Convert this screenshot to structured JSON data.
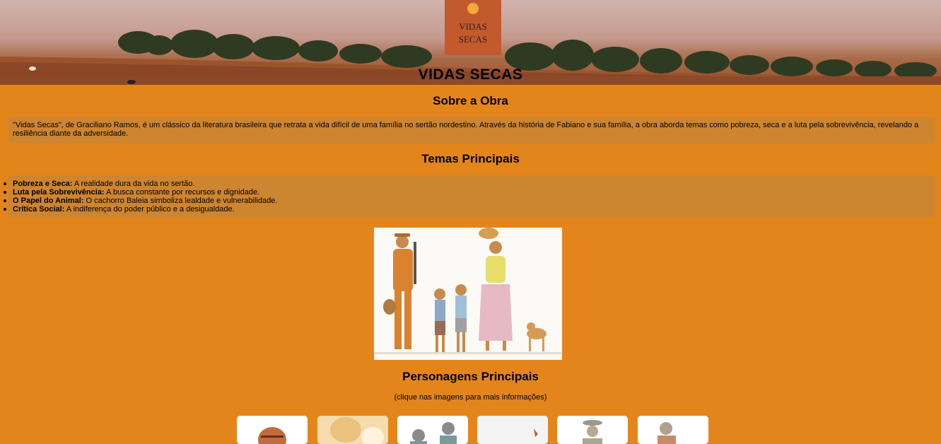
{
  "header": {
    "title": "VIDAS SECAS",
    "logo_text_line1": "VIDAS",
    "logo_text_line2": "SECAS"
  },
  "about": {
    "heading": "Sobre a Obra",
    "text": "\"Vidas Secas\", de Graciliano Ramos, é um clássico da literatura brasileira que retrata a vida difícil de uma família no sertão nordestino. Através da história de Fabiano e sua família, a obra aborda temas como pobreza, seca e a luta pela sobrevivência, revelando a resiliência diante da adversidade."
  },
  "themes": {
    "heading": "Temas Principais",
    "items": [
      {
        "title": "Pobreza e Seca:",
        "text": " A realidade dura da vida no sertão."
      },
      {
        "title": "Luta pela Sobrevivência:",
        "text": " A busca constante por recursos e dignidade."
      },
      {
        "title": "O Papel do Animal:",
        "text": " O cachorro Baleia simboliza lealdade e vulnerabilidade."
      },
      {
        "title": "Crítica Social:",
        "text": " A indiferença do poder público e a desigualdade."
      }
    ]
  },
  "characters": {
    "heading": "Personagens Principais",
    "hint": "(clique nas imagens para mais informações)"
  },
  "colors": {
    "page_background": "#e4851c",
    "panel_background": "#ce8530"
  }
}
